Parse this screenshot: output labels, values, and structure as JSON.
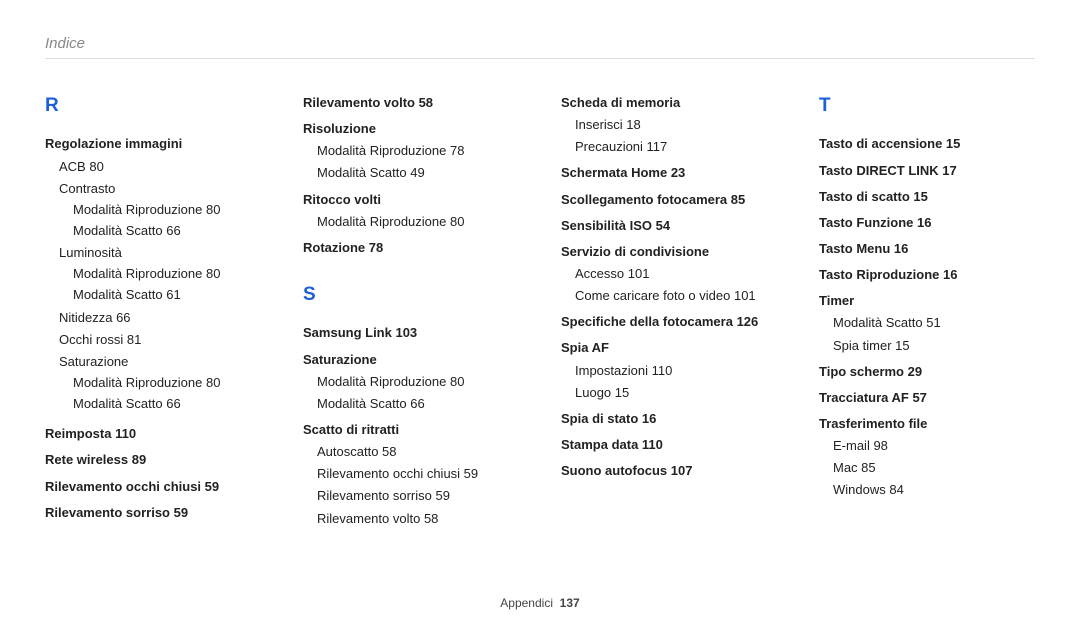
{
  "header": "Indice",
  "footer_label": "Appendici",
  "footer_page": "137",
  "col1": {
    "letter": "R",
    "rows": [
      {
        "cls": "topic",
        "t": "Regolazione immagini"
      },
      {
        "cls": "sub1",
        "t": "ACB  80"
      },
      {
        "cls": "sub1",
        "t": "Contrasto"
      },
      {
        "cls": "sub2",
        "t": "Modalità Riproduzione  80"
      },
      {
        "cls": "sub2",
        "t": "Modalità Scatto  66"
      },
      {
        "cls": "sub1",
        "t": "Luminosità"
      },
      {
        "cls": "sub2",
        "t": "Modalità Riproduzione  80"
      },
      {
        "cls": "sub2",
        "t": "Modalità Scatto  61"
      },
      {
        "cls": "sub1",
        "t": "Nitidezza  66"
      },
      {
        "cls": "sub1",
        "t": "Occhi rossi  81"
      },
      {
        "cls": "sub1",
        "t": "Saturazione"
      },
      {
        "cls": "sub2",
        "t": "Modalità Riproduzione  80"
      },
      {
        "cls": "sub2",
        "t": "Modalità Scatto  66"
      },
      {
        "cls": "topic",
        "t": "Reimposta  110",
        "mt": 10
      },
      {
        "cls": "topic",
        "t": "Rete wireless  89"
      },
      {
        "cls": "topic",
        "t": "Rilevamento occhi chiusi  59"
      },
      {
        "cls": "topic",
        "t": "Rilevamento sorriso  59"
      }
    ]
  },
  "col2": {
    "rows": [
      {
        "cls": "topic",
        "t": "Rilevamento volto  58"
      },
      {
        "cls": "topic",
        "t": "Risoluzione"
      },
      {
        "cls": "sub1",
        "t": "Modalità Riproduzione  78"
      },
      {
        "cls": "sub1",
        "t": "Modalità Scatto  49"
      },
      {
        "cls": "topic",
        "t": "Ritocco volti"
      },
      {
        "cls": "sub1",
        "t": "Modalità Riproduzione  80"
      },
      {
        "cls": "topic",
        "t": "Rotazione  78"
      }
    ],
    "letter": "S",
    "rows2": [
      {
        "cls": "topic",
        "t": "Samsung Link  103"
      },
      {
        "cls": "topic",
        "t": "Saturazione"
      },
      {
        "cls": "sub1",
        "t": "Modalità Riproduzione  80"
      },
      {
        "cls": "sub1",
        "t": "Modalità Scatto  66"
      },
      {
        "cls": "topic",
        "t": "Scatto di ritratti"
      },
      {
        "cls": "sub1",
        "t": "Autoscatto  58"
      },
      {
        "cls": "sub1",
        "t": "Rilevamento occhi chiusi  59"
      },
      {
        "cls": "sub1",
        "t": "Rilevamento sorriso  59"
      },
      {
        "cls": "sub1",
        "t": "Rilevamento volto  58"
      }
    ]
  },
  "col3": {
    "rows": [
      {
        "cls": "topic",
        "t": "Scheda di memoria"
      },
      {
        "cls": "sub1",
        "t": "Inserisci  18"
      },
      {
        "cls": "sub1",
        "t": "Precauzioni  117"
      },
      {
        "cls": "topic",
        "t": "Schermata Home  23"
      },
      {
        "cls": "topic",
        "t": "Scollegamento fotocamera  85"
      },
      {
        "cls": "topic",
        "t": "Sensibilità ISO  54"
      },
      {
        "cls": "topic",
        "t": "Servizio di condivisione"
      },
      {
        "cls": "sub1",
        "t": "Accesso  101"
      },
      {
        "cls": "sub1",
        "t": "Come caricare foto o video  101"
      },
      {
        "cls": "topic",
        "t": "Specifiche della fotocamera  126"
      },
      {
        "cls": "topic",
        "t": "Spia AF"
      },
      {
        "cls": "sub1",
        "t": "Impostazioni  110"
      },
      {
        "cls": "sub1",
        "t": "Luogo  15"
      },
      {
        "cls": "topic",
        "t": "Spia di stato  16"
      },
      {
        "cls": "topic",
        "t": "Stampa data  110"
      },
      {
        "cls": "topic",
        "t": "Suono autofocus  107"
      }
    ]
  },
  "col4": {
    "letter": "T",
    "rows": [
      {
        "cls": "topic",
        "t": "Tasto di accensione  15"
      },
      {
        "cls": "topic",
        "t": "Tasto DIRECT LINK  17"
      },
      {
        "cls": "topic",
        "t": "Tasto di scatto  15"
      },
      {
        "cls": "topic",
        "t": "Tasto Funzione  16"
      },
      {
        "cls": "topic",
        "t": "Tasto Menu  16"
      },
      {
        "cls": "topic",
        "t": "Tasto Riproduzione  16"
      },
      {
        "cls": "topic",
        "t": "Timer"
      },
      {
        "cls": "sub1",
        "t": "Modalità Scatto  51"
      },
      {
        "cls": "sub1",
        "t": "Spia timer  15"
      },
      {
        "cls": "topic",
        "t": "Tipo schermo  29"
      },
      {
        "cls": "topic",
        "t": "Tracciatura AF  57"
      },
      {
        "cls": "topic",
        "t": "Trasferimento file"
      },
      {
        "cls": "sub1",
        "t": "E-mail  98"
      },
      {
        "cls": "sub1",
        "t": "Mac  85"
      },
      {
        "cls": "sub1",
        "t": "Windows  84"
      }
    ]
  }
}
